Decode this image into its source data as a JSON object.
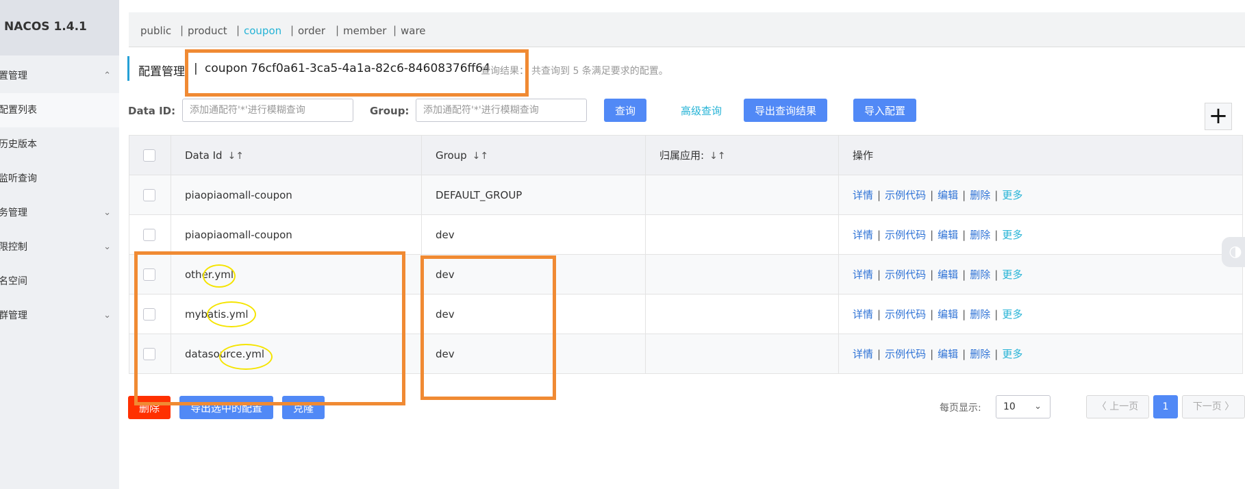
{
  "app": {
    "title": "NACOS 1.4.1"
  },
  "sidebar": {
    "items": [
      {
        "label": "置管理",
        "chevron": "^"
      },
      {
        "label": "配置列表"
      },
      {
        "label": "历史版本"
      },
      {
        "label": "监听查询"
      },
      {
        "label": "务管理",
        "chevron": "v"
      },
      {
        "label": "限控制",
        "chevron": "v"
      },
      {
        "label": "名空间"
      },
      {
        "label": "群管理",
        "chevron": "v"
      }
    ]
  },
  "namespaces": {
    "items": [
      "public",
      "product",
      "coupon",
      "order",
      "member",
      "ware"
    ],
    "active": "coupon",
    "separator": "|"
  },
  "header": {
    "title": "配置管理",
    "separator": "|",
    "namespace": "coupon",
    "namespace_id": "76cf0a61-3ca5-4a1a-82c6-84608376ff64",
    "result_label": "查询结果：",
    "result_text": "共查询到 5 条满足要求的配置。"
  },
  "query": {
    "data_id_label": "Data ID:",
    "data_id_placeholder": "添加通配符'*'进行模糊查询",
    "group_label": "Group:",
    "group_placeholder": "添加通配符'*'进行模糊查询",
    "search_button": "查询",
    "advanced_link": "高级查询",
    "export_button": "导出查询结果",
    "import_button": "导入配置",
    "add_button": "+"
  },
  "table": {
    "headers": [
      "Data Id",
      "Group",
      "归属应用:",
      "操作"
    ],
    "sort_icon": "↓↑",
    "rows": [
      {
        "data_id": "piaopiaomall-coupon",
        "group": "DEFAULT_GROUP",
        "app": ""
      },
      {
        "data_id": "piaopiaomall-coupon",
        "group": "dev",
        "app": ""
      },
      {
        "data_id": "other.yml",
        "group": "dev",
        "app": ""
      },
      {
        "data_id": "mybatis.yml",
        "group": "dev",
        "app": ""
      },
      {
        "data_id": "datasource.yml",
        "group": "dev",
        "app": ""
      }
    ],
    "actions": [
      "详情",
      "示例代码",
      "编辑",
      "删除",
      "更多"
    ],
    "action_separator": "|"
  },
  "bottom": {
    "delete_button": "删除",
    "export_selected_button": "导出选中的配置",
    "clone_button": "克隆",
    "page_size_label": "每页显示:",
    "page_size": "10",
    "prev_button": "〈 上一页",
    "current_page": "1",
    "next_button": "下一页 〉"
  },
  "colors": {
    "accent": "#5189f6",
    "link": "#2f73d6",
    "teal": "#25b3d6",
    "danger": "#ff3000",
    "annotation_box": "#f08a33",
    "annotation_ellipse": "#f5e400"
  }
}
